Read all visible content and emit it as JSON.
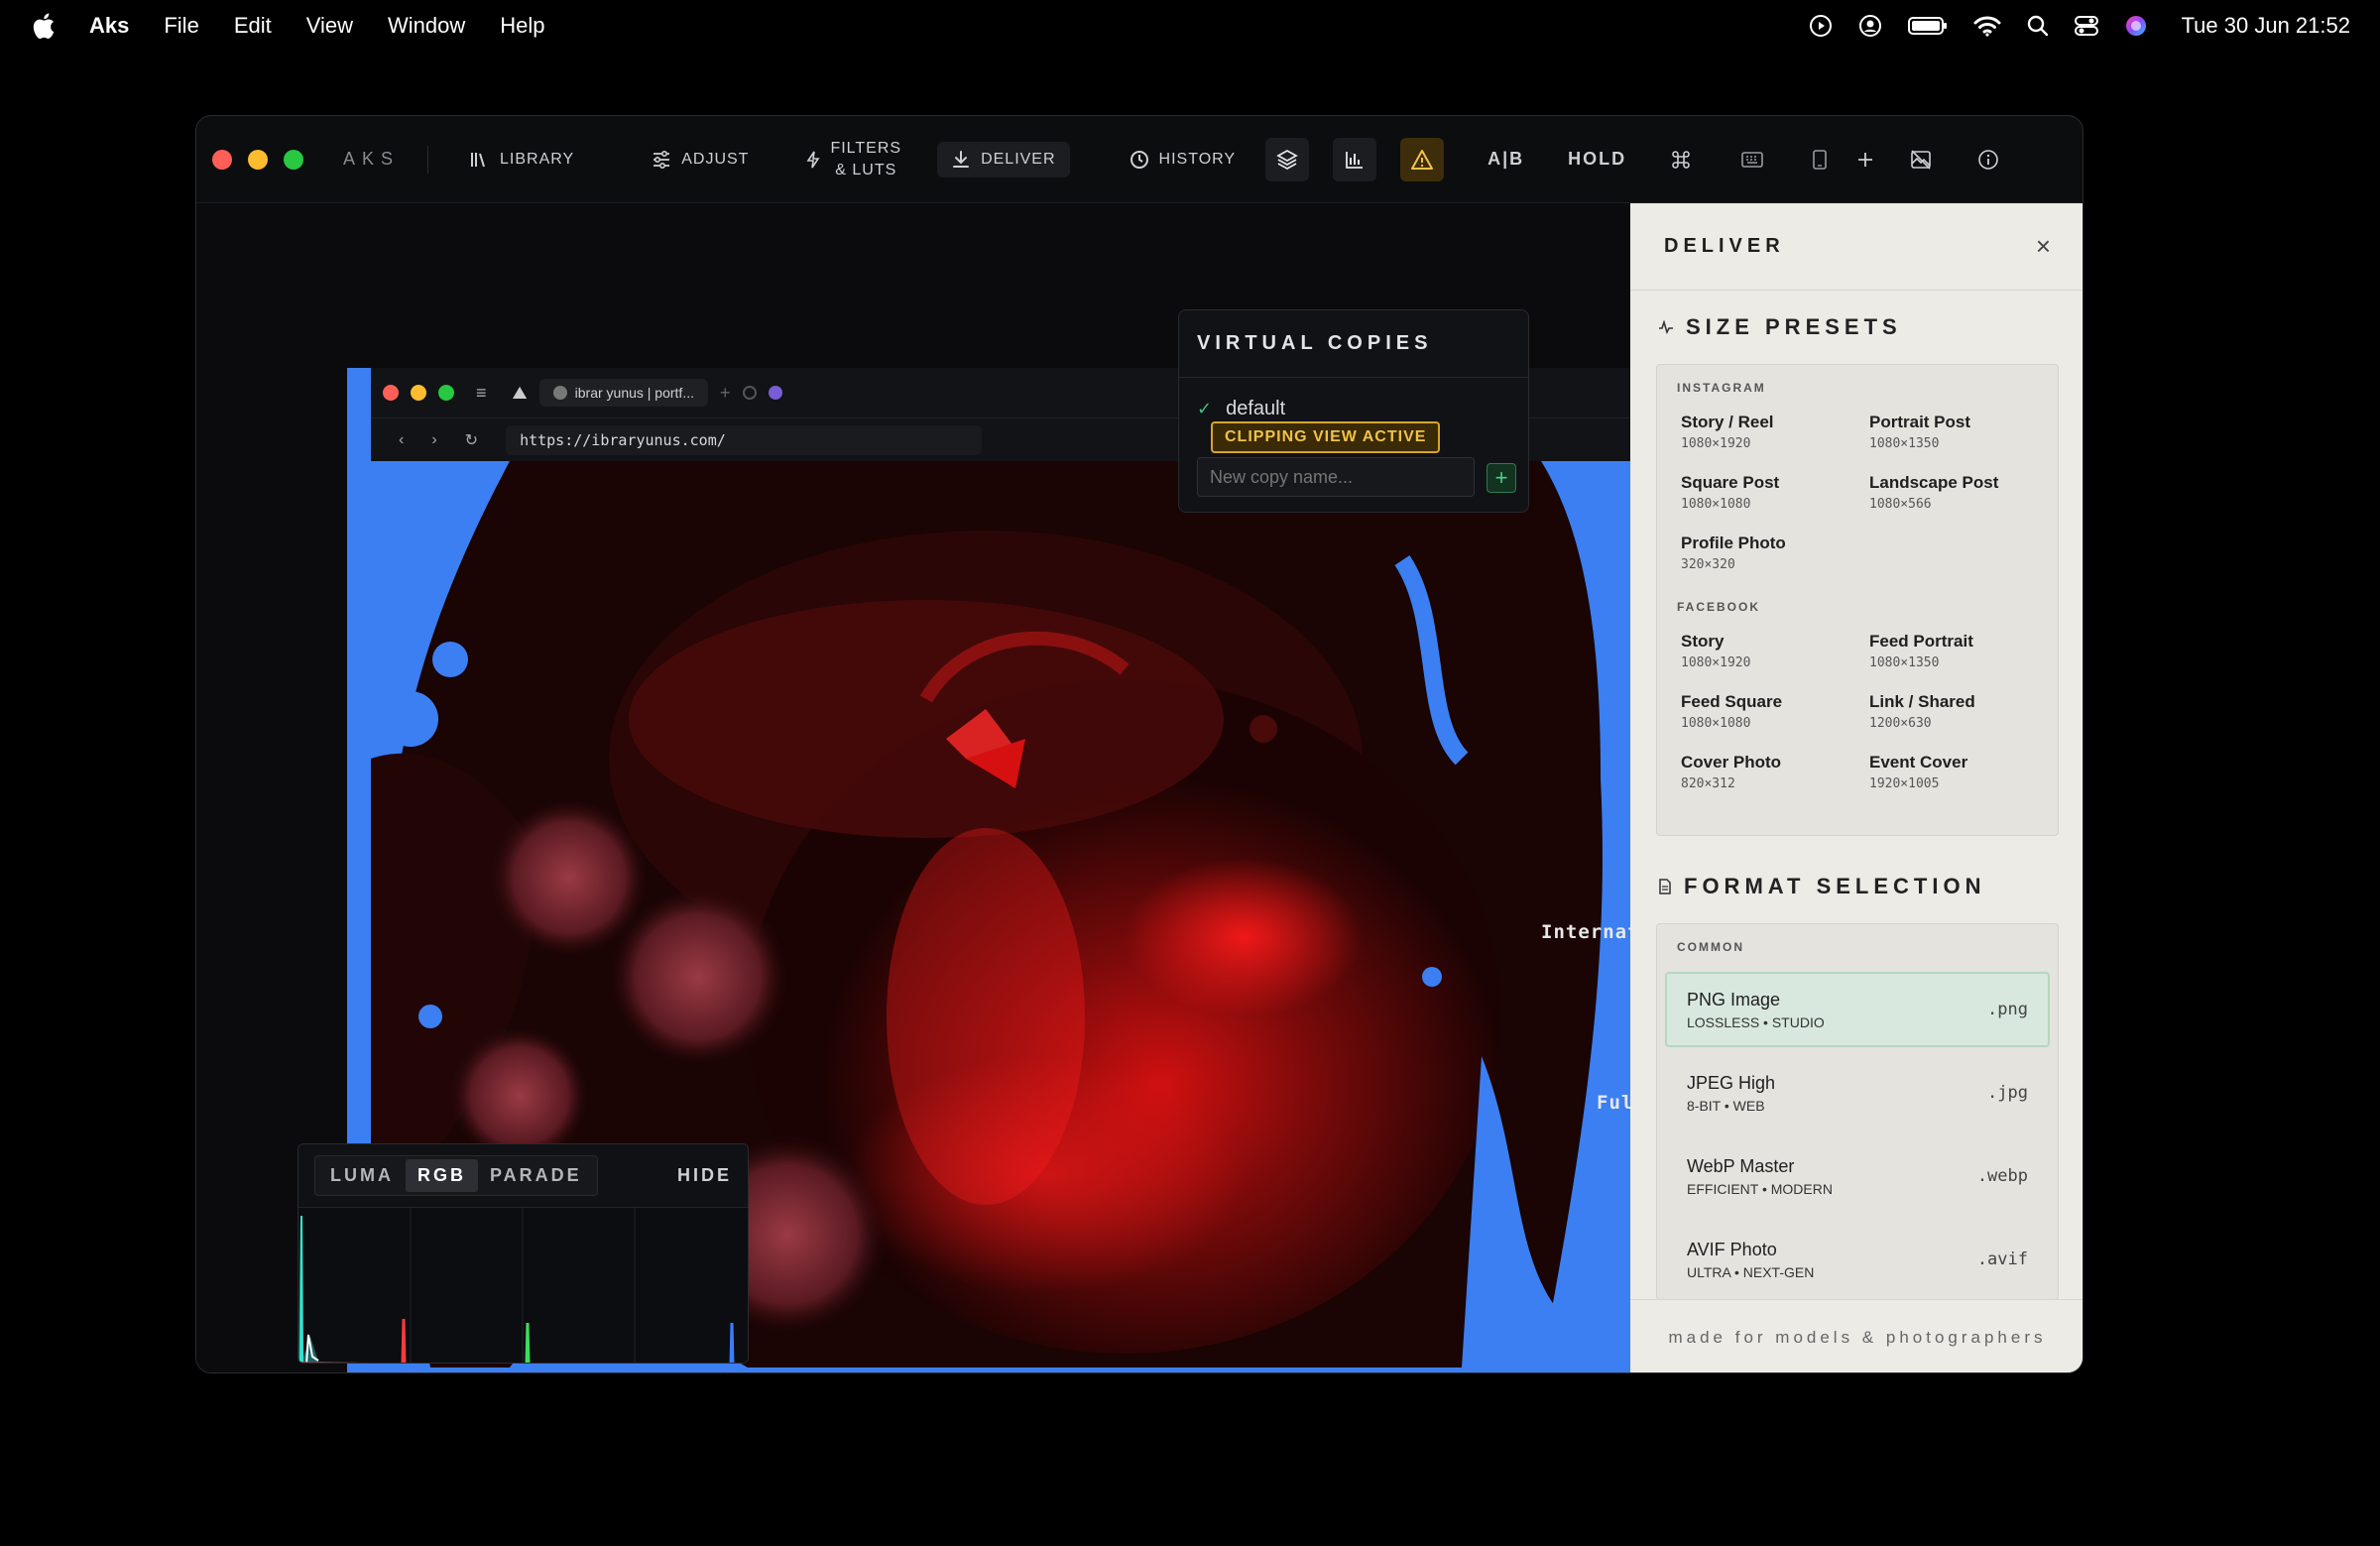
{
  "menubar": {
    "app_name": "Aks",
    "items": [
      "File",
      "Edit",
      "View",
      "Window",
      "Help"
    ],
    "clock": "Tue 30 Jun  21:52"
  },
  "toolbar": {
    "brand": "AKS",
    "library": "LIBRARY",
    "adjust": "ADJUST",
    "filters_line1": "FILTERS",
    "filters_line2": "& LUTS",
    "deliver": "DELIVER",
    "history": "HISTORY",
    "ab": "A|B",
    "hold": "HOLD"
  },
  "browser": {
    "tab_title": "ibrar yunus | portf...",
    "url": "https://ibraryunus.com/"
  },
  "image_overlay": {
    "text1": "Internatio",
    "text2": "Full"
  },
  "virtual_copies": {
    "title": "VIRTUAL COPIES",
    "copies": [
      "default"
    ],
    "clipping_badge": "CLIPPING VIEW ACTIVE",
    "new_copy_placeholder": "New copy name...",
    "add_label": "+"
  },
  "scope": {
    "tabs": [
      "LUMA",
      "RGB",
      "PARADE"
    ],
    "active_tab": "RGB",
    "hide_label": "HIDE"
  },
  "deliver": {
    "title": "DELIVER",
    "close": "×",
    "size_presets_title": "SIZE PRESETS",
    "groups": [
      {
        "label": "INSTAGRAM",
        "presets": [
          {
            "name": "Story / Reel",
            "size": "1080×1920"
          },
          {
            "name": "Portrait Post",
            "size": "1080×1350"
          },
          {
            "name": "Square Post",
            "size": "1080×1080"
          },
          {
            "name": "Landscape Post",
            "size": "1080×566"
          },
          {
            "name": "Profile Photo",
            "size": "320×320"
          }
        ]
      },
      {
        "label": "FACEBOOK",
        "presets": [
          {
            "name": "Story",
            "size": "1080×1920"
          },
          {
            "name": "Feed Portrait",
            "size": "1080×1350"
          },
          {
            "name": "Feed Square",
            "size": "1080×1080"
          },
          {
            "name": "Link / Shared",
            "size": "1200×630"
          },
          {
            "name": "Cover Photo",
            "size": "820×312"
          },
          {
            "name": "Event Cover",
            "size": "1920×1005"
          }
        ]
      }
    ],
    "format_title": "FORMAT SELECTION",
    "format_group": "COMMON",
    "formats": [
      {
        "name": "PNG Image",
        "sub": "LOSSLESS • STUDIO",
        "ext": ".png",
        "selected": true
      },
      {
        "name": "JPEG High",
        "sub": "8-BIT • WEB",
        "ext": ".jpg",
        "selected": false
      },
      {
        "name": "WebP Master",
        "sub": "EFFICIENT • MODERN",
        "ext": ".webp",
        "selected": false
      },
      {
        "name": "AVIF Photo",
        "sub": "ULTRA • NEXT-GEN",
        "ext": ".avif",
        "selected": false
      }
    ],
    "footer": "made for models & photographers"
  },
  "colors": {
    "clipping_blue": "#3b7ff2",
    "warning_amber": "#f0c24a",
    "panel_bg": "#ecebe6",
    "selected_format": "#d9e8de"
  }
}
